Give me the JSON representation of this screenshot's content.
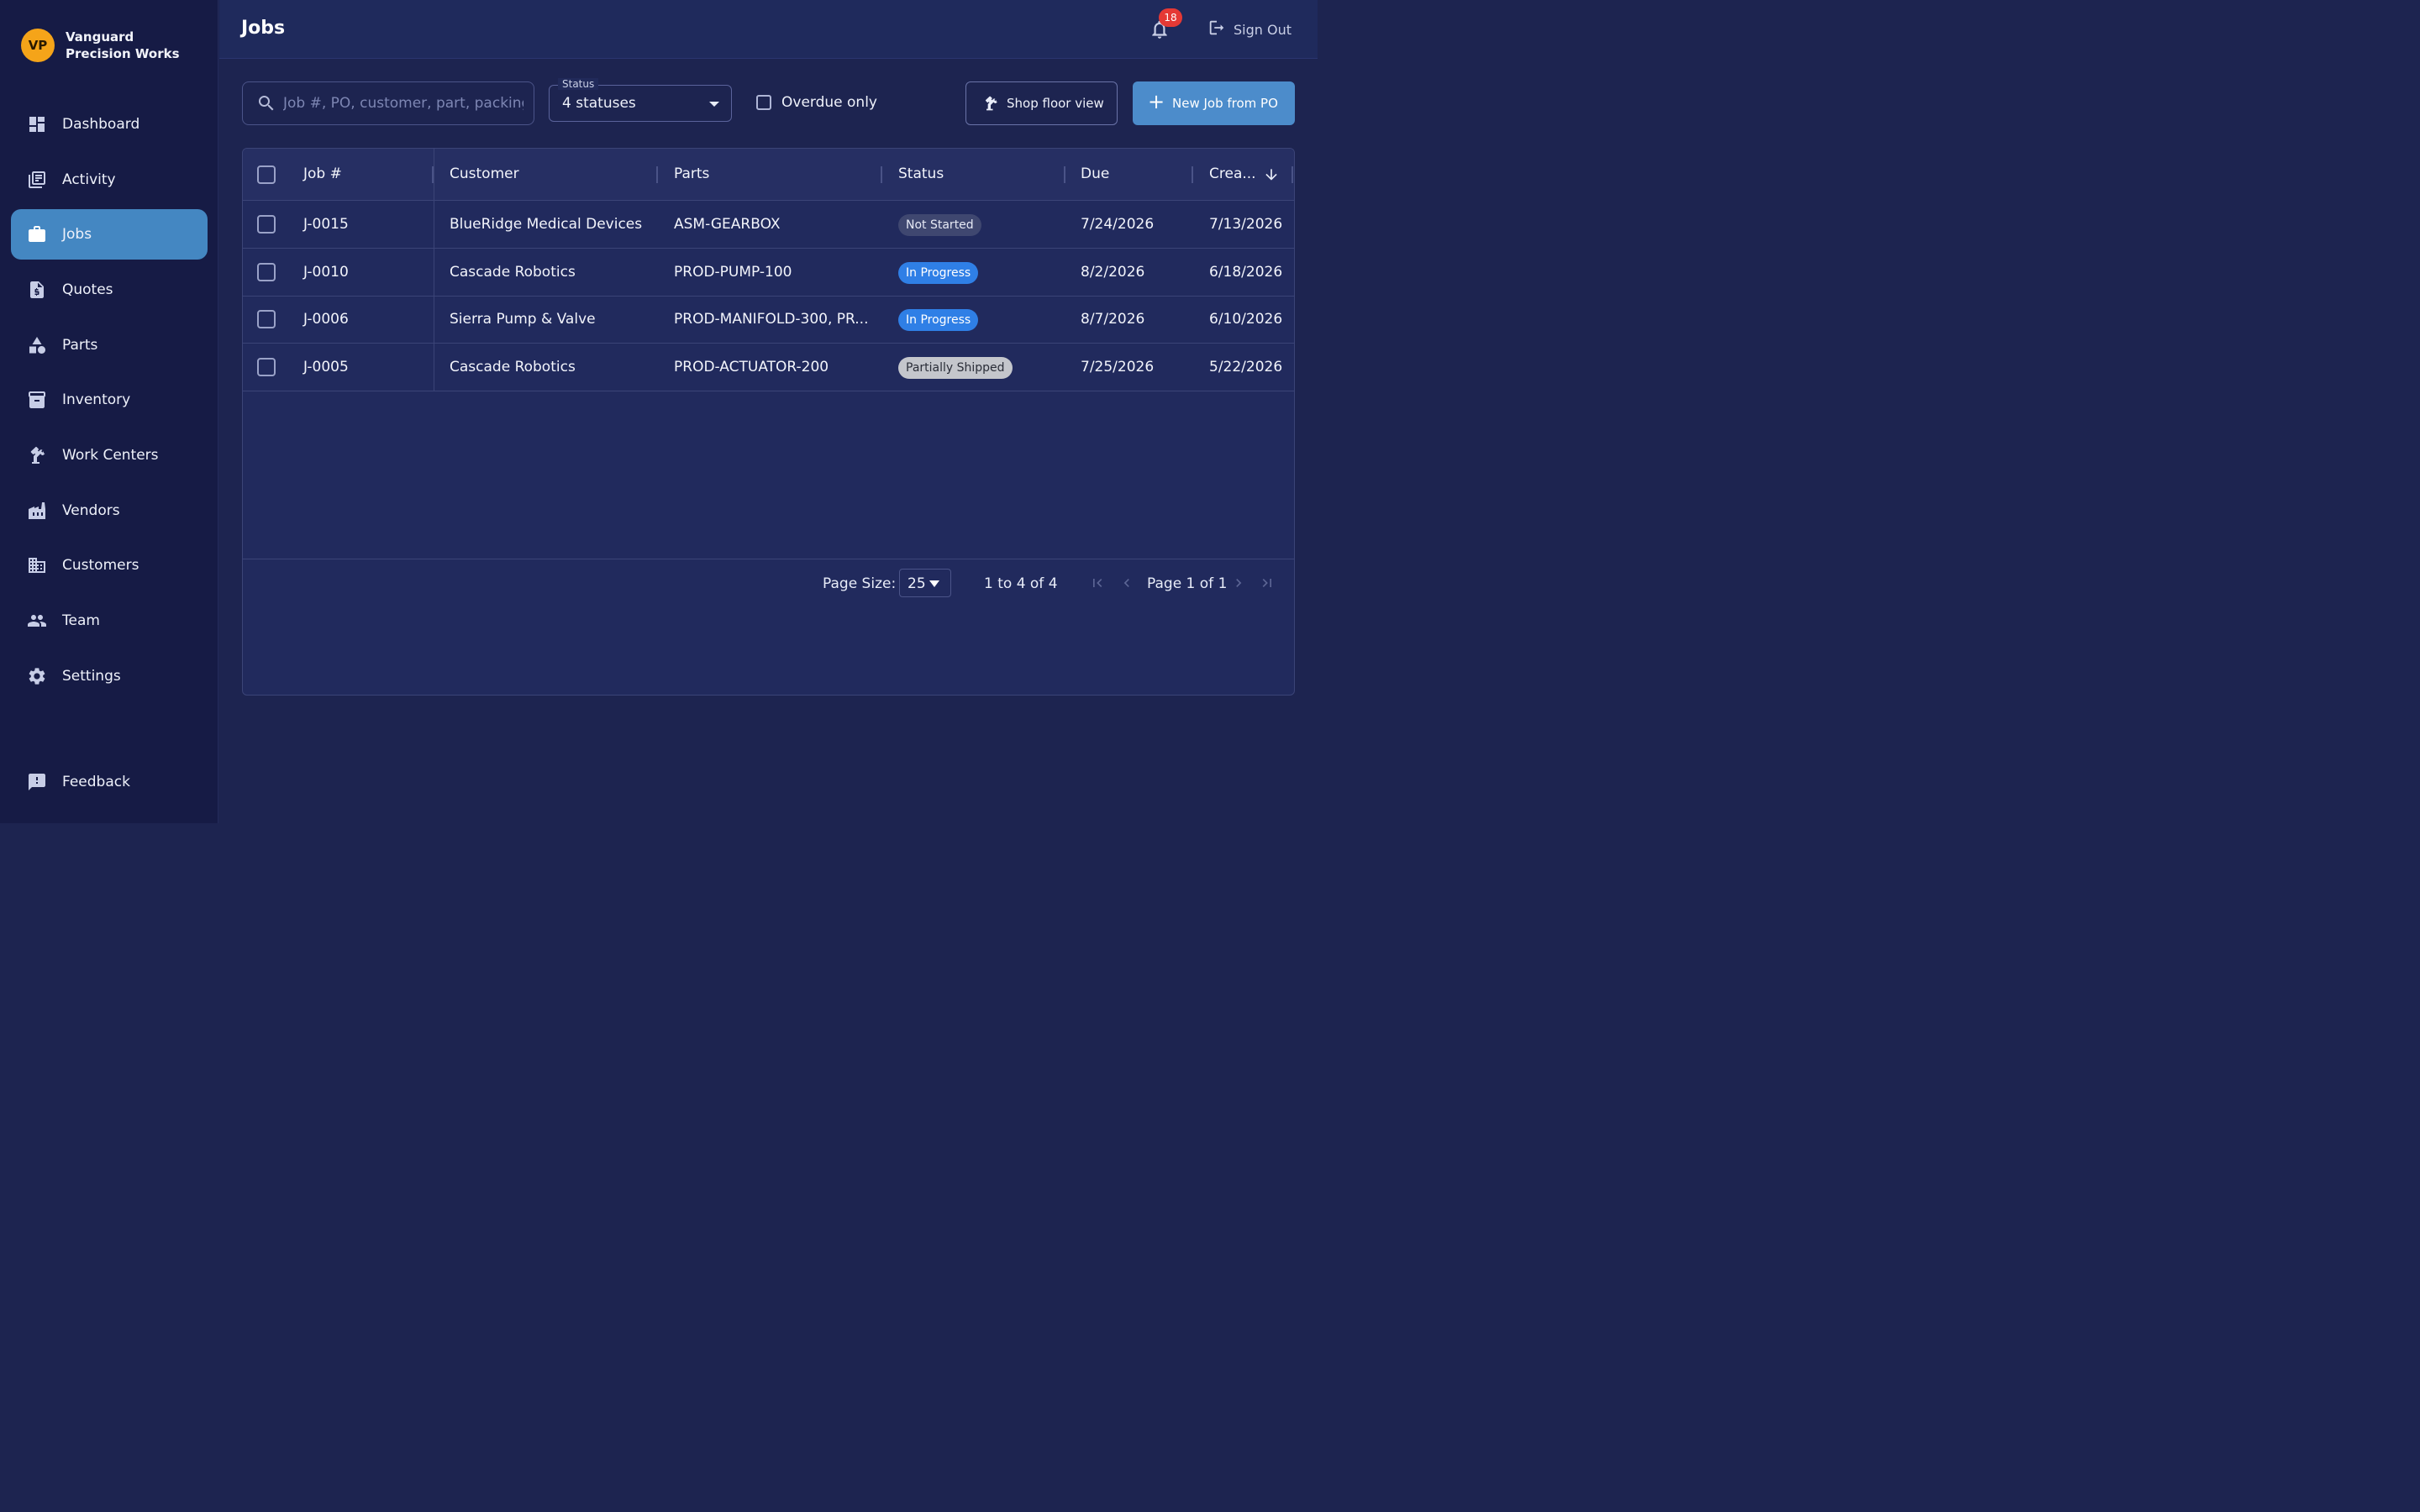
{
  "brand": {
    "initials": "VP",
    "name": "Vanguard Precision Works",
    "avatar_color": "#f5a419"
  },
  "sidebar": {
    "items": [
      {
        "label": "Dashboard",
        "icon": "dashboard-icon",
        "active": false
      },
      {
        "label": "Activity",
        "icon": "activity-icon",
        "active": false
      },
      {
        "label": "Jobs",
        "icon": "briefcase-icon",
        "active": true
      },
      {
        "label": "Quotes",
        "icon": "quote-document-icon",
        "active": false
      },
      {
        "label": "Parts",
        "icon": "shapes-icon",
        "active": false
      },
      {
        "label": "Inventory",
        "icon": "archive-box-icon",
        "active": false
      },
      {
        "label": "Work Centers",
        "icon": "robot-arm-icon",
        "active": false
      },
      {
        "label": "Vendors",
        "icon": "factory-icon",
        "active": false
      },
      {
        "label": "Customers",
        "icon": "building-icon",
        "active": false
      },
      {
        "label": "Team",
        "icon": "people-icon",
        "active": false
      },
      {
        "label": "Settings",
        "icon": "gear-icon",
        "active": false
      }
    ],
    "feedback": {
      "label": "Feedback",
      "icon": "feedback-icon"
    }
  },
  "header": {
    "title": "Jobs",
    "notification_count": "18",
    "signout_label": "Sign Out"
  },
  "toolbar": {
    "search_placeholder": "Job #, PO, customer, part, packing s",
    "status_label": "Status",
    "status_value": "4 statuses",
    "overdue_label": "Overdue only",
    "overdue_checked": false,
    "shop_floor_label": "Shop floor view",
    "new_job_label": "New Job from PO",
    "accent_color": "#4c8ccb"
  },
  "table": {
    "columns": [
      "Job #",
      "Customer",
      "Parts",
      "Status",
      "Due",
      "Crea..."
    ],
    "sort": {
      "column": "Crea...",
      "direction": "desc"
    },
    "rows": [
      {
        "job": "J-0015",
        "customer": "BlueRidge Medical Devices",
        "parts": "ASM-GEARBOX",
        "status": "Not Started",
        "due": "7/24/2026",
        "created": "7/13/2026"
      },
      {
        "job": "J-0010",
        "customer": "Cascade Robotics",
        "parts": "PROD-PUMP-100",
        "status": "In Progress",
        "due": "8/2/2026",
        "created": "6/18/2026"
      },
      {
        "job": "J-0006",
        "customer": "Sierra Pump & Valve",
        "parts": "PROD-MANIFOLD-300, PR...",
        "status": "In Progress",
        "due": "8/7/2026",
        "created": "6/10/2026"
      },
      {
        "job": "J-0005",
        "customer": "Cascade Robotics",
        "parts": "PROD-ACTUATOR-200",
        "status": "Partially Shipped",
        "due": "7/25/2026",
        "created": "5/22/2026"
      }
    ],
    "status_colors": {
      "Not Started": {
        "bg": "#3f4770",
        "fg": "#e6e9f5"
      },
      "In Progress": {
        "bg": "#2f7fe6",
        "fg": "#ffffff"
      },
      "Partially Shipped": {
        "bg": "#c4c6cc",
        "fg": "#2a2d38"
      }
    }
  },
  "pagination": {
    "page_size_label": "Page Size:",
    "page_size": "25",
    "range": "1 to 4 of 4",
    "page_text": "Page 1 of 1"
  }
}
